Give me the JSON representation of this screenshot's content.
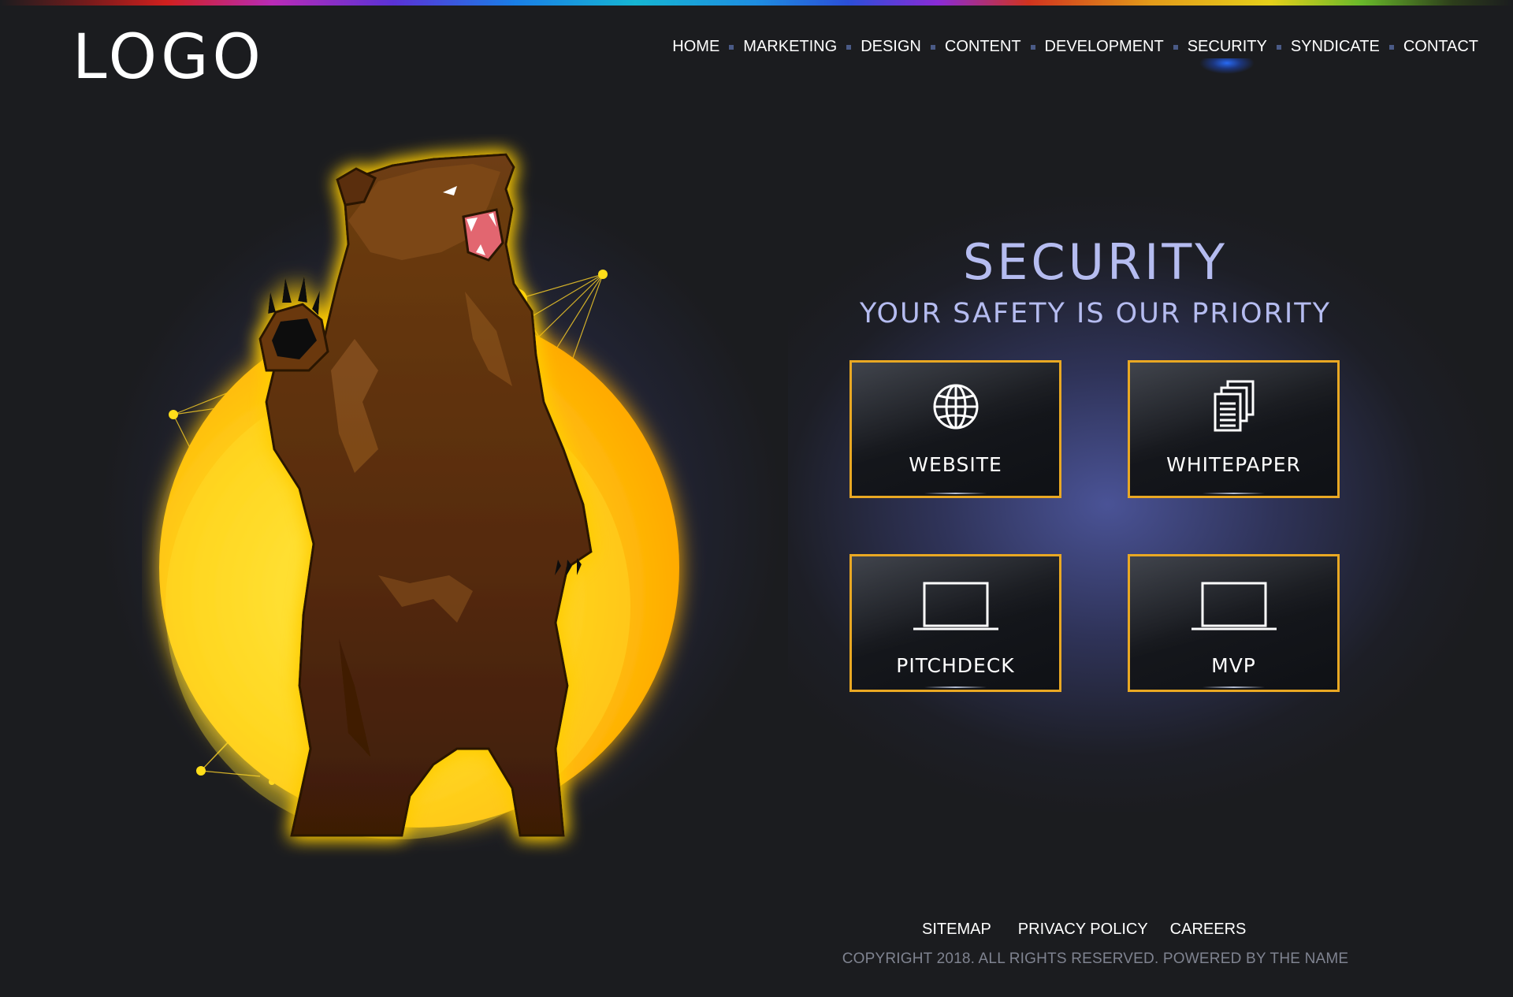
{
  "brand": {
    "logo_text": "LOGO"
  },
  "nav": {
    "items": [
      {
        "label": "HOME"
      },
      {
        "label": "MARKETING"
      },
      {
        "label": "DESIGN"
      },
      {
        "label": "CONTENT"
      },
      {
        "label": "DEVELOPMENT"
      },
      {
        "label": "SECURITY",
        "active": true
      },
      {
        "label": "SYNDICATE"
      },
      {
        "label": "CONTACT"
      }
    ]
  },
  "hero": {
    "illustration": "bear-roaring-icon",
    "title": "SECURITY",
    "subtitle": "YOUR SAFETY IS OUR PRIORITY"
  },
  "tiles": [
    {
      "label": "WEBSITE",
      "icon": "globe-icon"
    },
    {
      "label": "WHITEPAPER",
      "icon": "documents-icon"
    },
    {
      "label": "PITCHDECK",
      "icon": "laptop-icon"
    },
    {
      "label": "MVP",
      "icon": "laptop-icon"
    }
  ],
  "footer": {
    "links": [
      {
        "label": "SITEMAP"
      },
      {
        "label": "PRIVACY POLICY"
      },
      {
        "label": "CAREERS"
      }
    ],
    "copyright": "COPYRIGHT 2018. ALL RIGHTS RESERVED. POWERED BY THE NAME"
  },
  "colors": {
    "background": "#1b1c1f",
    "accent_gold": "#e9a823",
    "title_lavender": "#b5bcf0",
    "active_glow": "#286eff"
  }
}
